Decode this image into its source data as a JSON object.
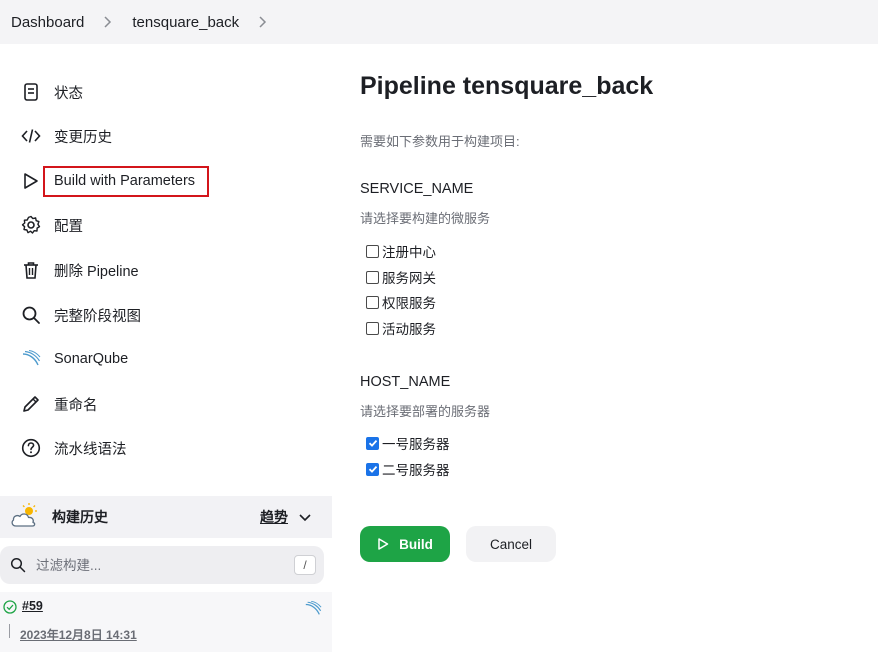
{
  "breadcrumb": {
    "items": [
      "Dashboard",
      "tensquare_back"
    ]
  },
  "sidebar": {
    "items": [
      {
        "label": "状态",
        "icon": "document-icon"
      },
      {
        "label": "变更历史",
        "icon": "code-icon"
      },
      {
        "label": "Build with Parameters",
        "icon": "play-icon"
      },
      {
        "label": "配置",
        "icon": "gear-icon"
      },
      {
        "label": "删除 Pipeline",
        "icon": "trash-icon"
      },
      {
        "label": "完整阶段视图",
        "icon": "search-icon"
      },
      {
        "label": "SonarQube",
        "icon": "sonarqube-icon"
      },
      {
        "label": "重命名",
        "icon": "pencil-icon"
      },
      {
        "label": "流水线语法",
        "icon": "help-icon"
      }
    ]
  },
  "history": {
    "title": "构建历史",
    "trend_label": "趋势",
    "filter_placeholder": "过滤构建...",
    "filter_shortcut": "/",
    "builds": [
      {
        "number": "#59",
        "date": "2023年12月8日 14:31",
        "status": "success"
      }
    ]
  },
  "main": {
    "title": "Pipeline tensquare_back",
    "intro": "需要如下参数用于构建项目:",
    "params": [
      {
        "name": "SERVICE_NAME",
        "description": "请选择要构建的微服务",
        "options": [
          {
            "label": "注册中心",
            "checked": false
          },
          {
            "label": "服务网关",
            "checked": false
          },
          {
            "label": "权限服务",
            "checked": false
          },
          {
            "label": "活动服务",
            "checked": false
          }
        ]
      },
      {
        "name": "HOST_NAME",
        "description": "请选择要部署的服务器",
        "options": [
          {
            "label": "一号服务器",
            "checked": true
          },
          {
            "label": "二号服务器",
            "checked": true
          }
        ]
      }
    ],
    "build_label": "Build",
    "cancel_label": "Cancel"
  },
  "colors": {
    "build_button": "#1ea446",
    "highlight_border": "#d3151b",
    "checkbox_checked": "#1a73e8"
  }
}
